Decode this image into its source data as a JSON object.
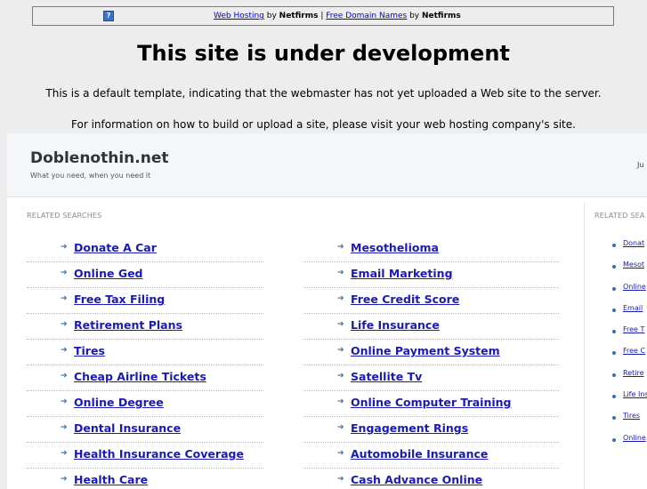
{
  "banner": {
    "icon": "question-mark-icon",
    "link1": "Web Hosting",
    "by1": " by ",
    "brand1": "Netfirms",
    "separator": " | ",
    "link2": "Free Domain Names",
    "by2": " by ",
    "brand2": "Netfirms"
  },
  "notice": {
    "title": "This site is under development",
    "line1": "This is a default template, indicating that the webmaster has not yet uploaded a Web site to the server.",
    "line2": "For information on how to build or upload a site, please visit your web hosting company's site."
  },
  "parked": {
    "domain": "Doblenothin.net",
    "tagline": "What you need, when you need it",
    "top_right": "Ju",
    "related_label": "RELATED SEARCHES",
    "side_label": "RELATED SEA",
    "left_links": [
      "Donate A Car",
      "Online Ged",
      "Free Tax Filing",
      "Retirement Plans",
      "Tires",
      "Cheap Airline Tickets",
      "Online Degree",
      "Dental Insurance",
      "Health Insurance Coverage",
      "Health Care"
    ],
    "right_links": [
      "Mesothelioma",
      "Email Marketing",
      "Free Credit Score",
      "Life Insurance",
      "Online Payment System",
      "Satellite Tv",
      "Online Computer Training",
      "Engagement Rings",
      "Automobile Insurance",
      "Cash Advance Online"
    ],
    "side_links": [
      "Donat",
      "Mesot",
      "Online",
      "Email",
      "Free T",
      "Free C",
      "Retire",
      "Life Ins",
      "Tires",
      "Online"
    ],
    "arrow_glyph": "➔"
  }
}
